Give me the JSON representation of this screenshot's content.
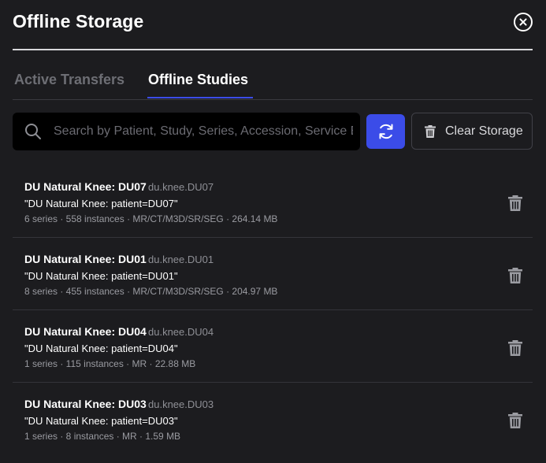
{
  "dialog": {
    "title": "Offline Storage",
    "close_icon": "close-circle-icon"
  },
  "tabs": [
    {
      "label": "Active Transfers",
      "active": false
    },
    {
      "label": "Offline Studies",
      "active": true
    }
  ],
  "search": {
    "placeholder": "Search by Patient, Study, Series, Accession, Service E",
    "value": "",
    "icon": "search-icon"
  },
  "toolbar": {
    "refresh_icon": "refresh-icon",
    "clear_label": "Clear Storage",
    "clear_icon": "trash-icon"
  },
  "colors": {
    "accent": "#3b4ce8",
    "background": "#1c1c1f",
    "search_background": "#000000"
  },
  "studies": [
    {
      "title": "DU Natural Knee: DU07",
      "id": "du.knee.DU07",
      "description": "\"DU Natural Knee: patient=DU07\"",
      "meta": "6 series · 558 instances · MR/CT/M3D/SR/SEG · 264.14 MB"
    },
    {
      "title": "DU Natural Knee: DU01",
      "id": "du.knee.DU01",
      "description": "\"DU Natural Knee: patient=DU01\"",
      "meta": "8 series · 455 instances · MR/CT/M3D/SR/SEG · 204.97 MB"
    },
    {
      "title": "DU Natural Knee: DU04",
      "id": "du.knee.DU04",
      "description": "\"DU Natural Knee: patient=DU04\"",
      "meta": "1 series · 115 instances · MR · 22.88 MB"
    },
    {
      "title": "DU Natural Knee: DU03",
      "id": "du.knee.DU03",
      "description": "\"DU Natural Knee: patient=DU03\"",
      "meta": "1 series · 8 instances · MR · 1.59 MB"
    }
  ]
}
